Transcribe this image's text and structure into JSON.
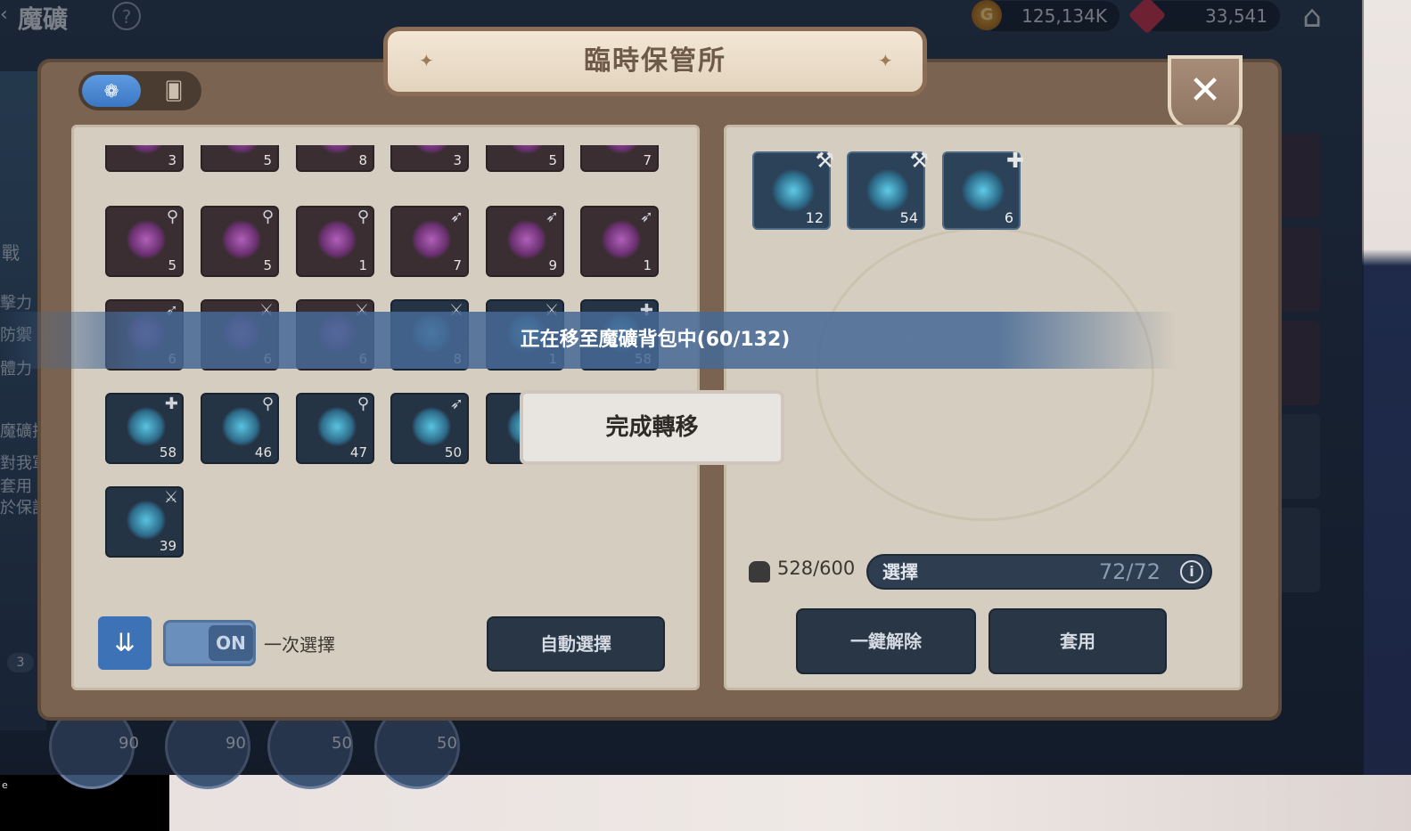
{
  "hud": {
    "title": "魔礦",
    "help_icon": "question-icon",
    "gold": "125,134K",
    "gold_icon": "G",
    "gems": "33,541"
  },
  "background": {
    "left_texts": [
      "戰",
      "擊力",
      "防禦",
      "體力",
      "魔礦技",
      "對我軍",
      "套用",
      "於保討"
    ],
    "hero_levels": [
      "90",
      "90",
      "50",
      "50"
    ],
    "badge_count": "3",
    "taskbar": "e"
  },
  "dialog": {
    "title": "臨時保管所",
    "close_symbol": "✕",
    "tabs": [
      {
        "name": "rune-tab",
        "icon": "❁",
        "selected": true
      },
      {
        "name": "card-tab",
        "icon": "🂠",
        "selected": false
      }
    ]
  },
  "left_panel": {
    "items": [
      {
        "color": "purple",
        "count": "3",
        "type": ""
      },
      {
        "color": "purple",
        "count": "5",
        "type": ""
      },
      {
        "color": "purple",
        "count": "8",
        "type": ""
      },
      {
        "color": "purple",
        "count": "3",
        "type": ""
      },
      {
        "color": "purple",
        "count": "5",
        "type": ""
      },
      {
        "color": "purple",
        "count": "7",
        "type": ""
      },
      {
        "color": "purple",
        "count": "5",
        "type": "⚲"
      },
      {
        "color": "purple",
        "count": "5",
        "type": "⚲"
      },
      {
        "color": "purple",
        "count": "1",
        "type": "⚲"
      },
      {
        "color": "purple",
        "count": "7",
        "type": "➶"
      },
      {
        "color": "purple",
        "count": "9",
        "type": "➶"
      },
      {
        "color": "purple",
        "count": "1",
        "type": "➶"
      },
      {
        "color": "purple",
        "count": "6",
        "type": "➶"
      },
      {
        "color": "purple",
        "count": "6",
        "type": "⚔"
      },
      {
        "color": "purple",
        "count": "6",
        "type": "⚔"
      },
      {
        "color": "teal",
        "count": "8",
        "type": "⚔"
      },
      {
        "color": "teal",
        "count": "1",
        "type": "⚔"
      },
      {
        "color": "teal",
        "count": "58",
        "type": "✚"
      },
      {
        "color": "teal",
        "count": "58",
        "type": "✚"
      },
      {
        "color": "teal",
        "count": "46",
        "type": "⚲"
      },
      {
        "color": "teal",
        "count": "47",
        "type": "⚲"
      },
      {
        "color": "teal",
        "count": "50",
        "type": "➶"
      },
      {
        "color": "teal",
        "count": "",
        "type": ""
      },
      {
        "color": "teal",
        "count": "",
        "type": ""
      },
      {
        "color": "teal",
        "count": "39",
        "type": "⚔"
      }
    ],
    "sort_icon": "⇊",
    "toggle_state": "ON",
    "toggle_label": "一次選擇",
    "auto_select_label": "自動選擇"
  },
  "right_panel": {
    "slots": [
      {
        "count": "12",
        "type": "⚒"
      },
      {
        "count": "54",
        "type": "⚒"
      },
      {
        "count": "6",
        "type": "✚"
      }
    ],
    "capacity": "528/600",
    "select_label": "選擇",
    "select_count": "72/72",
    "info_icon": "i",
    "clear_label": "一鍵解除",
    "apply_label": "套用"
  },
  "overlay": {
    "progress_text": "正在移至魔礦背包中(60/132)",
    "complete_label": "完成轉移"
  },
  "colors": {
    "frame_brown": "#7a6350",
    "panel_beige": "#d5cdbf",
    "accent_blue": "#3e72b6",
    "button_dark": "#293646"
  }
}
